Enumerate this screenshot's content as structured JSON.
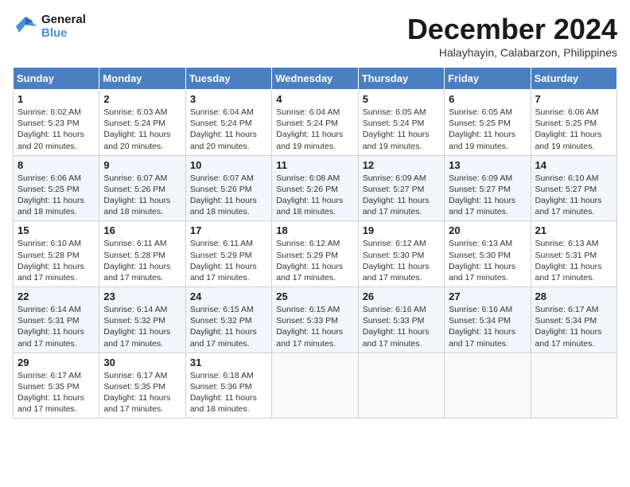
{
  "header": {
    "logo_line1": "General",
    "logo_line2": "Blue",
    "month": "December 2024",
    "location": "Halayhayin, Calabarzon, Philippines"
  },
  "days_of_week": [
    "Sunday",
    "Monday",
    "Tuesday",
    "Wednesday",
    "Thursday",
    "Friday",
    "Saturday"
  ],
  "weeks": [
    [
      {
        "day": "1",
        "info": "Sunrise: 6:02 AM\nSunset: 5:23 PM\nDaylight: 11 hours and 20 minutes."
      },
      {
        "day": "2",
        "info": "Sunrise: 6:03 AM\nSunset: 5:24 PM\nDaylight: 11 hours and 20 minutes."
      },
      {
        "day": "3",
        "info": "Sunrise: 6:04 AM\nSunset: 5:24 PM\nDaylight: 11 hours and 20 minutes."
      },
      {
        "day": "4",
        "info": "Sunrise: 6:04 AM\nSunset: 5:24 PM\nDaylight: 11 hours and 19 minutes."
      },
      {
        "day": "5",
        "info": "Sunrise: 6:05 AM\nSunset: 5:24 PM\nDaylight: 11 hours and 19 minutes."
      },
      {
        "day": "6",
        "info": "Sunrise: 6:05 AM\nSunset: 5:25 PM\nDaylight: 11 hours and 19 minutes."
      },
      {
        "day": "7",
        "info": "Sunrise: 6:06 AM\nSunset: 5:25 PM\nDaylight: 11 hours and 19 minutes."
      }
    ],
    [
      {
        "day": "8",
        "info": "Sunrise: 6:06 AM\nSunset: 5:25 PM\nDaylight: 11 hours and 18 minutes."
      },
      {
        "day": "9",
        "info": "Sunrise: 6:07 AM\nSunset: 5:26 PM\nDaylight: 11 hours and 18 minutes."
      },
      {
        "day": "10",
        "info": "Sunrise: 6:07 AM\nSunset: 5:26 PM\nDaylight: 11 hours and 18 minutes."
      },
      {
        "day": "11",
        "info": "Sunrise: 6:08 AM\nSunset: 5:26 PM\nDaylight: 11 hours and 18 minutes."
      },
      {
        "day": "12",
        "info": "Sunrise: 6:09 AM\nSunset: 5:27 PM\nDaylight: 11 hours and 17 minutes."
      },
      {
        "day": "13",
        "info": "Sunrise: 6:09 AM\nSunset: 5:27 PM\nDaylight: 11 hours and 17 minutes."
      },
      {
        "day": "14",
        "info": "Sunrise: 6:10 AM\nSunset: 5:27 PM\nDaylight: 11 hours and 17 minutes."
      }
    ],
    [
      {
        "day": "15",
        "info": "Sunrise: 6:10 AM\nSunset: 5:28 PM\nDaylight: 11 hours and 17 minutes."
      },
      {
        "day": "16",
        "info": "Sunrise: 6:11 AM\nSunset: 5:28 PM\nDaylight: 11 hours and 17 minutes."
      },
      {
        "day": "17",
        "info": "Sunrise: 6:11 AM\nSunset: 5:29 PM\nDaylight: 11 hours and 17 minutes."
      },
      {
        "day": "18",
        "info": "Sunrise: 6:12 AM\nSunset: 5:29 PM\nDaylight: 11 hours and 17 minutes."
      },
      {
        "day": "19",
        "info": "Sunrise: 6:12 AM\nSunset: 5:30 PM\nDaylight: 11 hours and 17 minutes."
      },
      {
        "day": "20",
        "info": "Sunrise: 6:13 AM\nSunset: 5:30 PM\nDaylight: 11 hours and 17 minutes."
      },
      {
        "day": "21",
        "info": "Sunrise: 6:13 AM\nSunset: 5:31 PM\nDaylight: 11 hours and 17 minutes."
      }
    ],
    [
      {
        "day": "22",
        "info": "Sunrise: 6:14 AM\nSunset: 5:31 PM\nDaylight: 11 hours and 17 minutes."
      },
      {
        "day": "23",
        "info": "Sunrise: 6:14 AM\nSunset: 5:32 PM\nDaylight: 11 hours and 17 minutes."
      },
      {
        "day": "24",
        "info": "Sunrise: 6:15 AM\nSunset: 5:32 PM\nDaylight: 11 hours and 17 minutes."
      },
      {
        "day": "25",
        "info": "Sunrise: 6:15 AM\nSunset: 5:33 PM\nDaylight: 11 hours and 17 minutes."
      },
      {
        "day": "26",
        "info": "Sunrise: 6:16 AM\nSunset: 5:33 PM\nDaylight: 11 hours and 17 minutes."
      },
      {
        "day": "27",
        "info": "Sunrise: 6:16 AM\nSunset: 5:34 PM\nDaylight: 11 hours and 17 minutes."
      },
      {
        "day": "28",
        "info": "Sunrise: 6:17 AM\nSunset: 5:34 PM\nDaylight: 11 hours and 17 minutes."
      }
    ],
    [
      {
        "day": "29",
        "info": "Sunrise: 6:17 AM\nSunset: 5:35 PM\nDaylight: 11 hours and 17 minutes."
      },
      {
        "day": "30",
        "info": "Sunrise: 6:17 AM\nSunset: 5:35 PM\nDaylight: 11 hours and 17 minutes."
      },
      {
        "day": "31",
        "info": "Sunrise: 6:18 AM\nSunset: 5:36 PM\nDaylight: 11 hours and 18 minutes."
      },
      {
        "day": "",
        "info": ""
      },
      {
        "day": "",
        "info": ""
      },
      {
        "day": "",
        "info": ""
      },
      {
        "day": "",
        "info": ""
      }
    ]
  ]
}
